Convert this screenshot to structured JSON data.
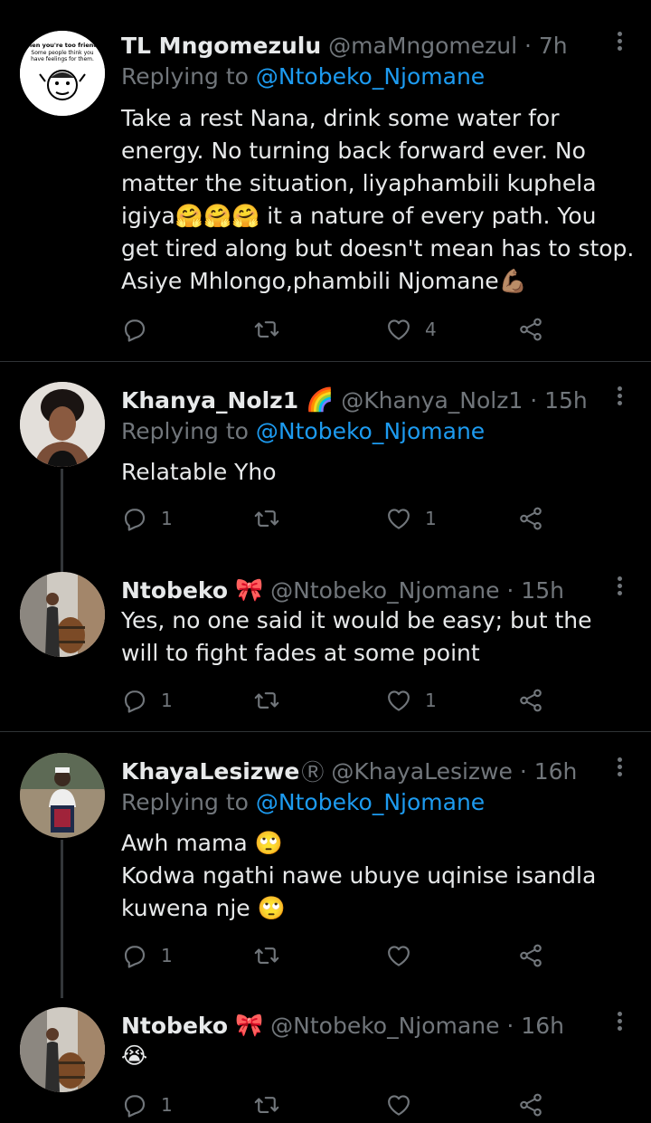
{
  "tweets": [
    {
      "name": "TL Mngomezulu",
      "meta": "@maMngomezul · 7h",
      "replying_prefix": "Replying to",
      "replying_handle": "@Ntobeko_Njomane",
      "lines": [
        "Take a rest Nana, drink some water for",
        "energy. No turning back forward ever. No",
        "matter the situation, liyaphambili kuphela",
        "igiya🤗🤗🤗 it a nature of every path. You",
        "get tired along but doesn't mean has to stop.",
        "Asiye Mhlongo,phambili Njomane💪🏽"
      ],
      "avatar_text": "When you're too friendly Some people think you have feelings for them.",
      "replies": "",
      "retweets": "",
      "likes": "4"
    },
    {
      "name": "Khanya_Nolz1",
      "badge": "🌈",
      "meta": "@Khanya_Nolz1 · 15h",
      "replying_prefix": "Replying to",
      "replying_handle": "@Ntobeko_Njomane",
      "lines": [
        "Relatable Yho"
      ],
      "replies": "1",
      "retweets": "",
      "likes": "1"
    },
    {
      "name": "Ntobeko",
      "badge": "🎀",
      "meta": "@Ntobeko_Njomane · 15h",
      "lines": [
        "Yes, no one said it would be easy; but the",
        "will to fight fades at some point"
      ],
      "replies": "1",
      "retweets": "",
      "likes": "1"
    },
    {
      "name": "KhayaLesizwe",
      "badge": "Ⓡ",
      "meta": "@KhayaLesizwe · 16h",
      "replying_prefix": "Replying to",
      "replying_handle": "@Ntobeko_Njomane",
      "lines": [
        "Awh mama 🙄",
        "Kodwa ngathi nawe ubuye uqinise isandla",
        "kuwena nje 🙄"
      ],
      "replies": "1",
      "retweets": "",
      "likes": ""
    },
    {
      "name": "Ntobeko",
      "badge": "🎀",
      "meta": "@Ntobeko_Njomane · 16h",
      "lines": [
        "😭"
      ],
      "replies": "1",
      "retweets": "",
      "likes": ""
    }
  ],
  "colors": {
    "background": "#000000",
    "text": "#e7e9ea",
    "muted": "#71767b",
    "link": "#1d9bf0",
    "separator": "#2f3336"
  },
  "icons": [
    "reply-icon",
    "retweet-icon",
    "like-icon",
    "share-icon",
    "more-icon"
  ]
}
